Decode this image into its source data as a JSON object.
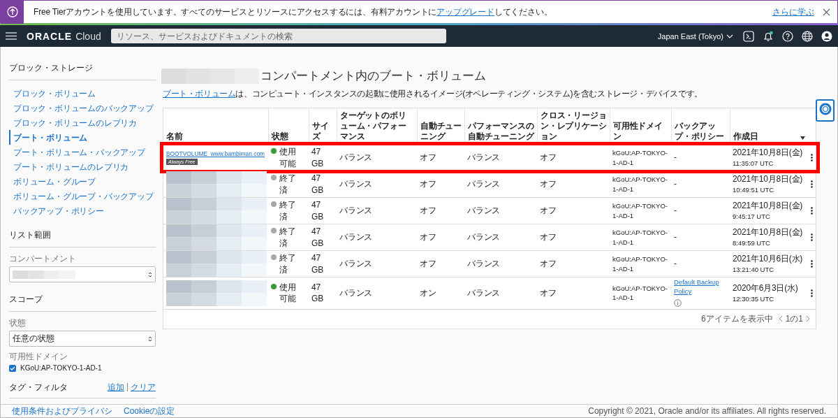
{
  "banner": {
    "text_before": "Free Tierアカウントを使用しています。すべてのサービスとリソースにアクセスするには、有料アカウントに",
    "link": "アップグレード",
    "text_after": "してください。",
    "learn_more": "さらに学ぶ"
  },
  "nav": {
    "brand": "ORACLE",
    "product": "Cloud",
    "search_placeholder": "リソース、サービスおよびドキュメントの検索",
    "region": "Japan East (Tokyo)"
  },
  "sidebar": {
    "title": "ブロック・ストレージ",
    "items": [
      {
        "label": "ブロック・ボリューム",
        "selected": false
      },
      {
        "label": "ブロック・ボリュームのバックアップ",
        "selected": false
      },
      {
        "label": "ブロック・ボリュームのレプリカ",
        "selected": false
      },
      {
        "label": "ブート・ボリューム",
        "selected": true
      },
      {
        "label": "ブート・ボリューム・バックアップ",
        "selected": false
      },
      {
        "label": "ブート・ボリュームのレプリカ",
        "selected": false
      },
      {
        "label": "ボリューム・グループ",
        "selected": false
      },
      {
        "label": "ボリューム・グループ・バックアップ",
        "selected": false
      },
      {
        "label": "バックアップ・ポリシー",
        "selected": false
      }
    ],
    "list_scope": {
      "heading": "リスト範囲",
      "compartment_label": "コンパートメント"
    },
    "scope": {
      "heading": "スコープ",
      "state_label": "状態",
      "state_value": "任意の状態",
      "domain_label": "可用性ドメイン",
      "domain": {
        "label": "KGoU:AP-TOKYO-1-AD-1",
        "checked": true
      }
    },
    "tag_filter": {
      "heading": "タグ・フィルタ",
      "add": "追加",
      "separator": "|",
      "clear": "クリア"
    }
  },
  "main": {
    "title": "コンパートメント内のブート・ボリューム",
    "desc_link": "ブート・ボリューム",
    "desc_text": "は、コンピュート・インスタンスの起動に使用されるイメージ(オペレーティング・システム)を含むストレージ・デバイスです。",
    "table": {
      "columns": [
        {
          "label": "名前",
          "sorted": false
        },
        {
          "label": "状態",
          "sorted": false
        },
        {
          "label": "サイズ",
          "sorted": false
        },
        {
          "label": "ターゲットのボリューム・パフォーマンス",
          "sorted": false
        },
        {
          "label": "自動チューニング",
          "sorted": false
        },
        {
          "label": "パフォーマンスの自動チューニング",
          "sorted": false
        },
        {
          "label": "クロス・リージョン・レプリケーション",
          "sorted": false
        },
        {
          "label": "可用性ドメイン",
          "sorted": false
        },
        {
          "label": "バックアップ・ポリシー",
          "sorted": false
        },
        {
          "label": "作成日",
          "sorted": true
        }
      ],
      "rows": [
        {
          "name": "BOOTVOLUME_www.bambiman.com",
          "badge": "Always Free",
          "status": "使用可能",
          "color": "#3a9a3a",
          "size": "47 GB",
          "target": "バランス",
          "auto_tune": "オフ",
          "perf_tune": "バランス",
          "cross_region": "オフ",
          "domain": "kGoU:AP-TOKYO-1-AD-1",
          "backup": "-",
          "backup_link": false,
          "created_date": "2021年10月8日(金)",
          "created_time": "11:35:07 UTC",
          "highlighted": true
        },
        {
          "status": "終了済",
          "color": "#a8a8a8",
          "size": "47 GB",
          "target": "バランス",
          "auto_tune": "オフ",
          "perf_tune": "バランス",
          "cross_region": "オフ",
          "domain": "kGoU:AP-TOKYO-1-AD-1",
          "backup": "-",
          "backup_link": false,
          "created_date": "2021年10月8日(金)",
          "created_time": "10:49:51 UTC",
          "highlighted": false
        },
        {
          "status": "終了済",
          "color": "#a8a8a8",
          "size": "47 GB",
          "target": "バランス",
          "auto_tune": "オフ",
          "perf_tune": "バランス",
          "cross_region": "オフ",
          "domain": "kGoU:AP-TOKYO-1-AD-1",
          "backup": "-",
          "backup_link": false,
          "created_date": "2021年10月8日(金)",
          "created_time": "9:45:17 UTC",
          "highlighted": false
        },
        {
          "status": "終了済",
          "color": "#a8a8a8",
          "size": "47 GB",
          "target": "バランス",
          "auto_tune": "オフ",
          "perf_tune": "バランス",
          "cross_region": "オフ",
          "domain": "kGoU:AP-TOKYO-1-AD-1",
          "backup": "-",
          "backup_link": false,
          "created_date": "2021年10月8日(金)",
          "created_time": "8:49:59 UTC",
          "highlighted": false
        },
        {
          "status": "終了済",
          "color": "#a8a8a8",
          "size": "47 GB",
          "target": "バランス",
          "auto_tune": "オフ",
          "perf_tune": "バランス",
          "cross_region": "オフ",
          "domain": "kGoU:AP-TOKYO-1-AD-1",
          "backup": "-",
          "backup_link": false,
          "created_date": "2021年10月6日(水)",
          "created_time": "13:21:40 UTC",
          "highlighted": false
        },
        {
          "status": "使用可能",
          "color": "#3a9a3a",
          "size": "47 GB",
          "target": "バランス",
          "auto_tune": "オン",
          "perf_tune": "バランス",
          "cross_region": "オフ",
          "domain": "kGoU:AP-TOKYO-1-AD-1",
          "backup": "Default Backup Policy",
          "backup_link": true,
          "created_date": "2020年6月3日(水)",
          "created_time": "12:30:35 UTC",
          "highlighted": false
        }
      ],
      "item_count": "6アイテムを表示中",
      "page": "1の1"
    }
  },
  "footer": {
    "links": [
      "使用条件およびプライバシ",
      "Cookieの設定"
    ],
    "copyright": "Copyright © 2021, Oracle and/or its affiliates. All rights reserved."
  }
}
